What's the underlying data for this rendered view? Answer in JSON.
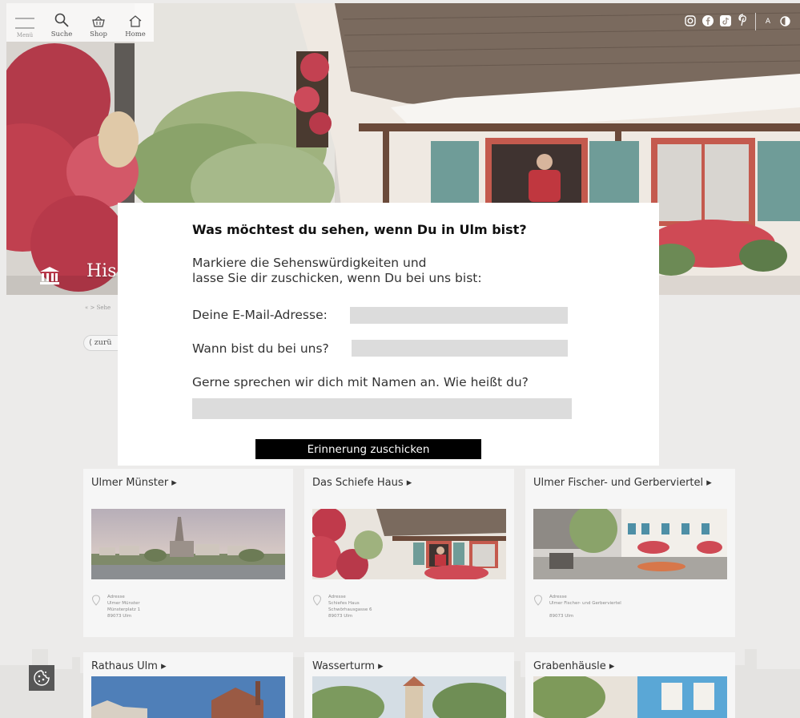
{
  "nav": {
    "menu_label": "Menü",
    "search_label": "Suche",
    "shop_label": "Shop",
    "home_label": "Home"
  },
  "social": {
    "icons": [
      "instagram-icon",
      "facebook-icon",
      "tiktok-icon",
      "pinterest-icon"
    ],
    "font_size_label": "A",
    "contrast_icon": "contrast-icon"
  },
  "hero": {
    "title": "His"
  },
  "breadcrumb": "« > Sehe",
  "back_label": "zurü",
  "modal": {
    "title": "Was möchtest du sehen, wenn Du in Ulm bist?",
    "intro_line1": "Markiere die Sehenswürdigkeiten und",
    "intro_line2": "lasse Sie dir zuschicken, wenn Du bei uns bist:",
    "email_label": "Deine E-Mail-Adresse:",
    "email_value": "",
    "date_label": "Wann bist du bei uns?",
    "date_value": "",
    "name_label": "Gerne sprechen wir dich mit Namen an. Wie heißt du?",
    "name_value": "",
    "submit_label": "Erinnerung zuschicken"
  },
  "cards": [
    {
      "title": "Ulmer Münster ▸",
      "addr_label": "Adresse",
      "addr_name": "Ulmer Münster",
      "addr_street": "Münsterplatz 1",
      "addr_city": "89073 Ulm"
    },
    {
      "title": "Das Schiefe Haus ▸",
      "addr_label": "Adresse",
      "addr_name": "Schiefes Haus",
      "addr_street": "Schwörhausgasse 6",
      "addr_city": "89073 Ulm"
    },
    {
      "title": "Ulmer Fischer- und Gerberviertel ▸",
      "addr_label": "Adresse",
      "addr_name": "Ulmer Fischer- und Gerberviertel",
      "addr_street": "",
      "addr_city": "89073 Ulm"
    },
    {
      "title": "Rathaus Ulm ▸"
    },
    {
      "title": "Wasserturm ▸"
    },
    {
      "title": "Grabenhäusle ▸"
    }
  ],
  "colors": {
    "page_bg": "#ecebea",
    "card_bg": "#f6f6f6",
    "input_bg": "#dcdcdc",
    "button_bg": "#000000",
    "cookie_bg": "#575757"
  }
}
